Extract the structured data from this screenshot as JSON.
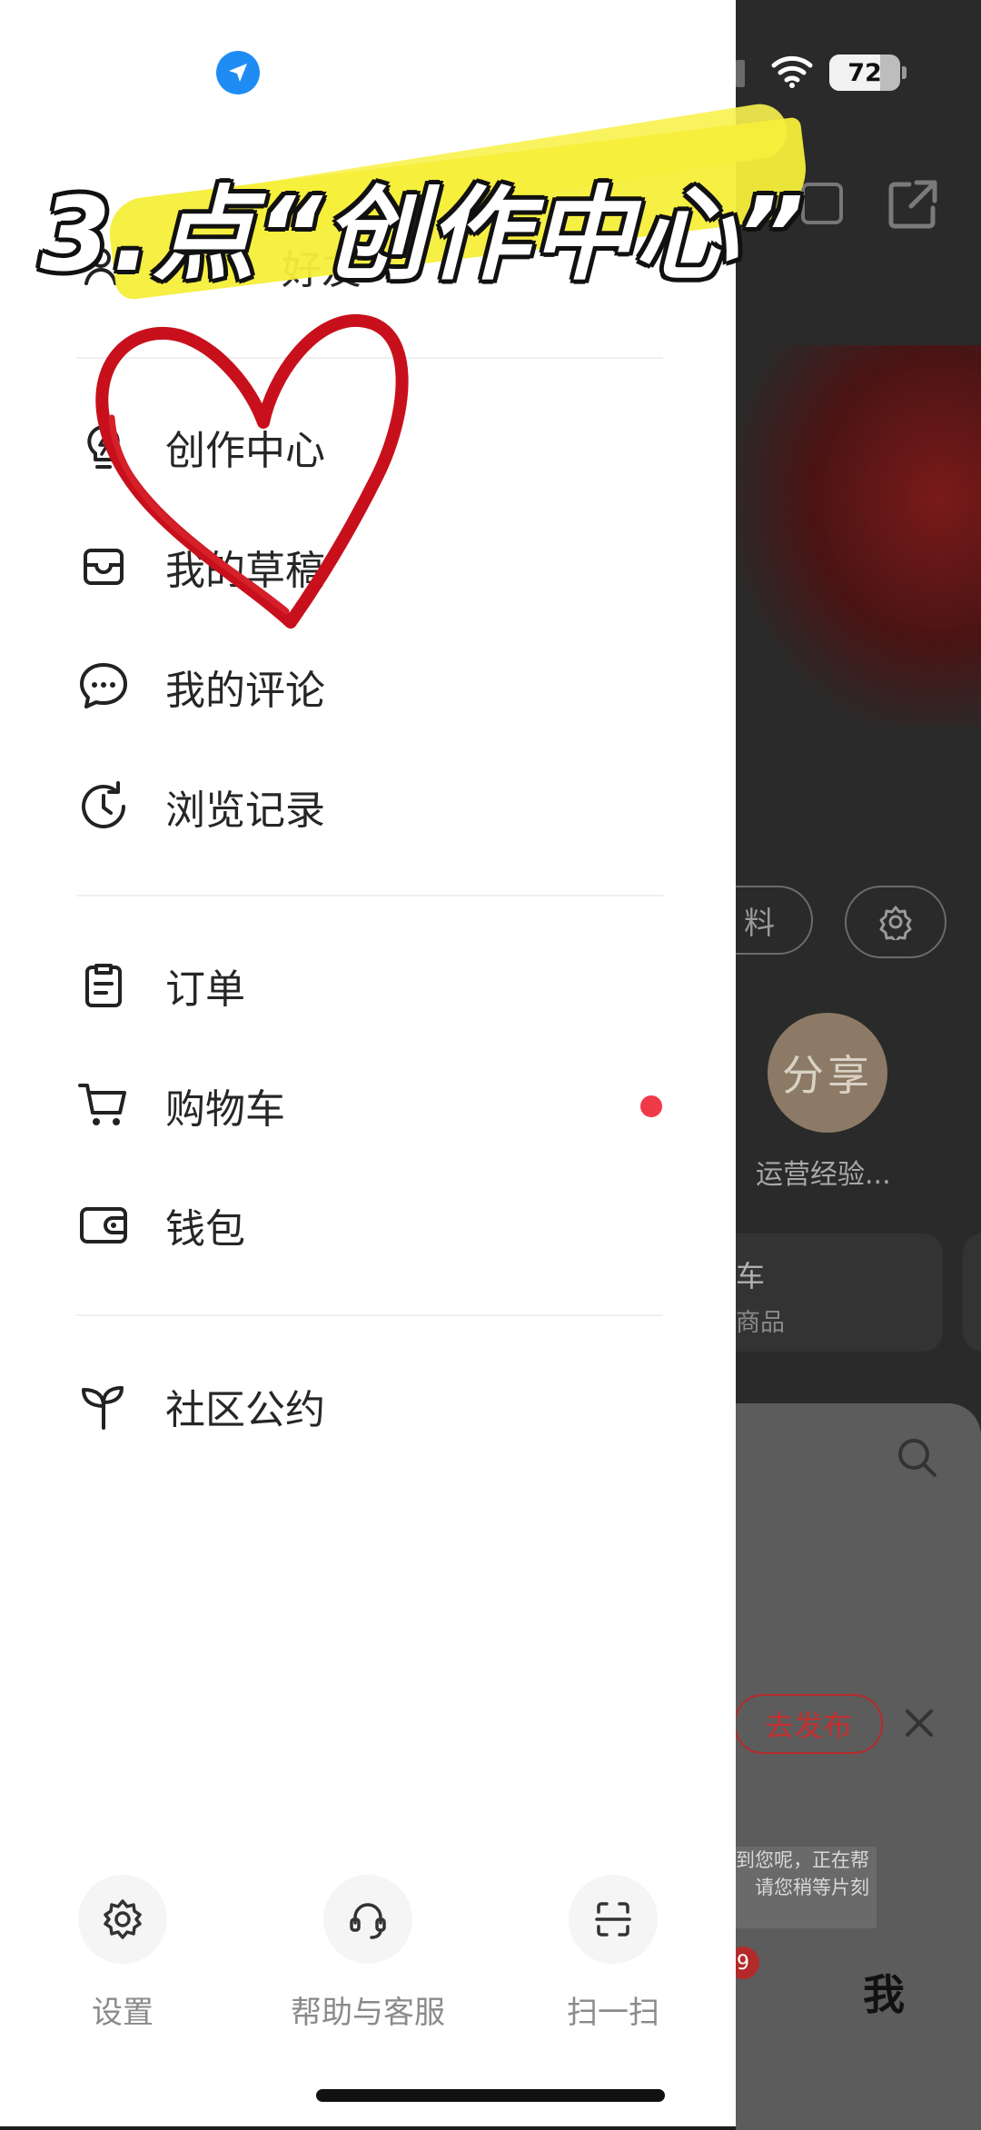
{
  "status_bar": {
    "battery": "72",
    "battery_fraction": 0.72
  },
  "annotation": {
    "text": "3.点“创作中心”"
  },
  "drawer": {
    "partial_top_item": "好友",
    "menu_group_1": [
      {
        "label": "创作中心",
        "icon": "lightbulb-icon"
      },
      {
        "label": "我的草稿",
        "icon": "inbox-icon"
      },
      {
        "label": "我的评论",
        "icon": "comment-icon"
      },
      {
        "label": "浏览记录",
        "icon": "history-icon"
      }
    ],
    "menu_group_2": [
      {
        "label": "订单",
        "icon": "clipboard-icon"
      },
      {
        "label": "购物车",
        "icon": "cart-icon",
        "has_dot": true
      },
      {
        "label": "钱包",
        "icon": "wallet-icon"
      }
    ],
    "menu_group_3": [
      {
        "label": "社区公约",
        "icon": "sprout-icon"
      }
    ],
    "bottom_actions": [
      {
        "label": "设置",
        "icon": "gear-icon"
      },
      {
        "label": "帮助与客服",
        "icon": "headset-icon"
      },
      {
        "label": "扫一扫",
        "icon": "scan-icon"
      }
    ]
  },
  "background": {
    "pill_label": "料",
    "avatar_text": "分享",
    "avatar_caption": "运营经验...",
    "card_title": "车",
    "card_sub": "商品",
    "post_button": "去发布",
    "toast_line1": "到您呢，正在帮",
    "toast_line2": "请您稍等片刻",
    "badge": "9",
    "tab_me": "我"
  },
  "colors": {
    "accent_red": "#f03a4a",
    "location_blue": "#1f8cf4",
    "highlight_yellow": "#f6ee3a"
  }
}
